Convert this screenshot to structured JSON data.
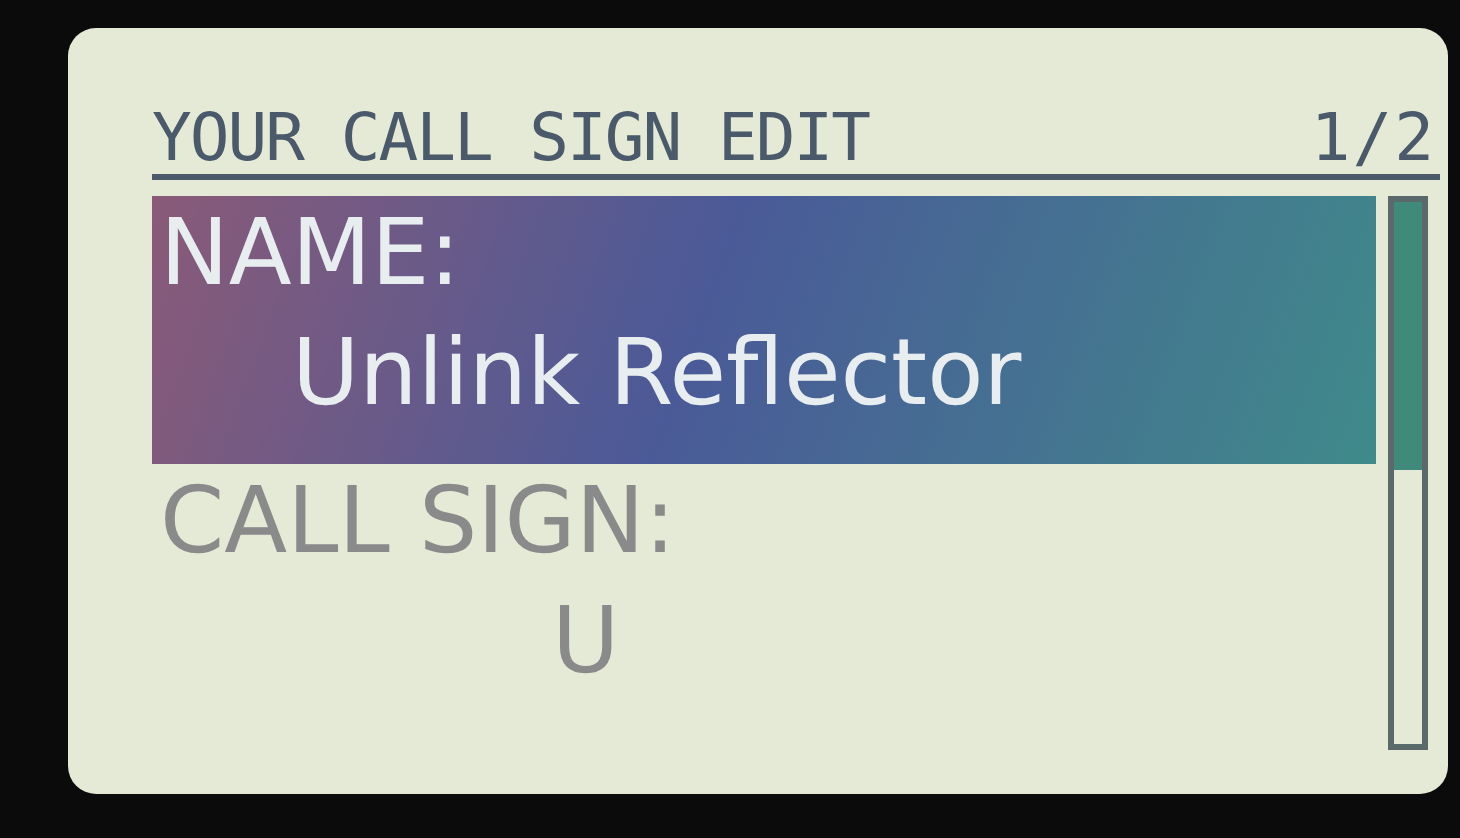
{
  "header": {
    "title": "YOUR CALL SIGN EDIT",
    "page": "1/2"
  },
  "fields": [
    {
      "label": "NAME:",
      "value": "Unlink Reflector",
      "selected": true
    },
    {
      "label": "CALL SIGN:",
      "value": "U",
      "selected": false
    }
  ]
}
